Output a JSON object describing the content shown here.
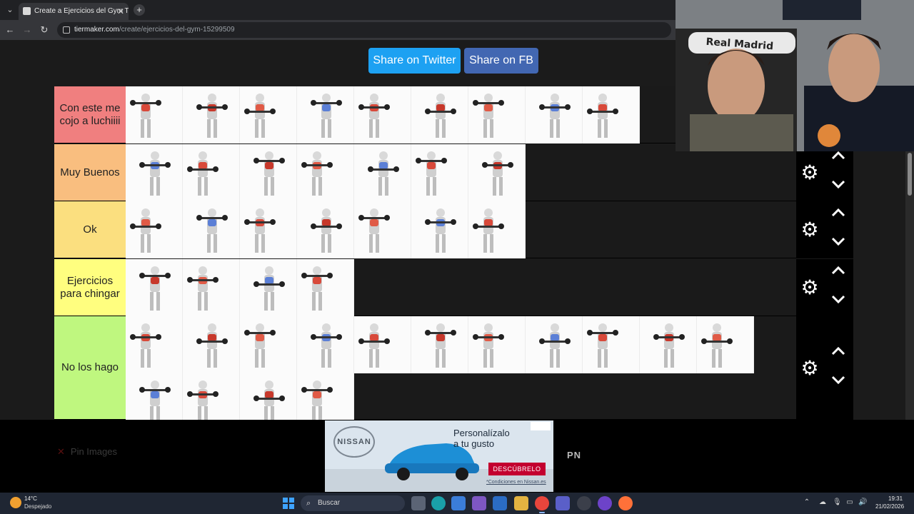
{
  "browser": {
    "tab_title": "Create a Ejercicios del Gym Tie",
    "url_host": "tiermaker.com",
    "url_path": "/create/ejercicios-del-gym-15299509"
  },
  "share": {
    "twitter_label": "Share on Twitter",
    "facebook_label": "Share on FB"
  },
  "tiers": [
    {
      "label": "Con este me cojo a luchiiii",
      "color": "#f07f7f",
      "items": 9
    },
    {
      "label": "Muy Buenos",
      "color": "#f9be7f",
      "items": 7
    },
    {
      "label": "Ok",
      "color": "#fbdf7f",
      "items": 7
    },
    {
      "label": "Ejercicios para chingar",
      "color": "#fffe7f",
      "items": 4
    },
    {
      "label": "No los hago",
      "color": "#bff77f",
      "items": 15
    }
  ],
  "tier_controls": {
    "settings_icon": "gear-icon",
    "up_icon": "chevron-up-icon",
    "down_icon": "chevron-down-icon"
  },
  "overlay": {
    "pin_images": "Pin Images",
    "pn_logo": "PN",
    "webcam_text": "Real Madrid"
  },
  "ad": {
    "brand": "NISSAN",
    "headline_1": "Personalízalo",
    "headline_2": "a tu gusto",
    "cta": "DESCÚBRELO",
    "fine_print": "*Condiciones en Nissan.es"
  },
  "taskbar": {
    "temperature": "14°C",
    "weather": "Despejado",
    "search_placeholder": "Buscar",
    "time": "19:31",
    "date": "21/02/2026"
  }
}
